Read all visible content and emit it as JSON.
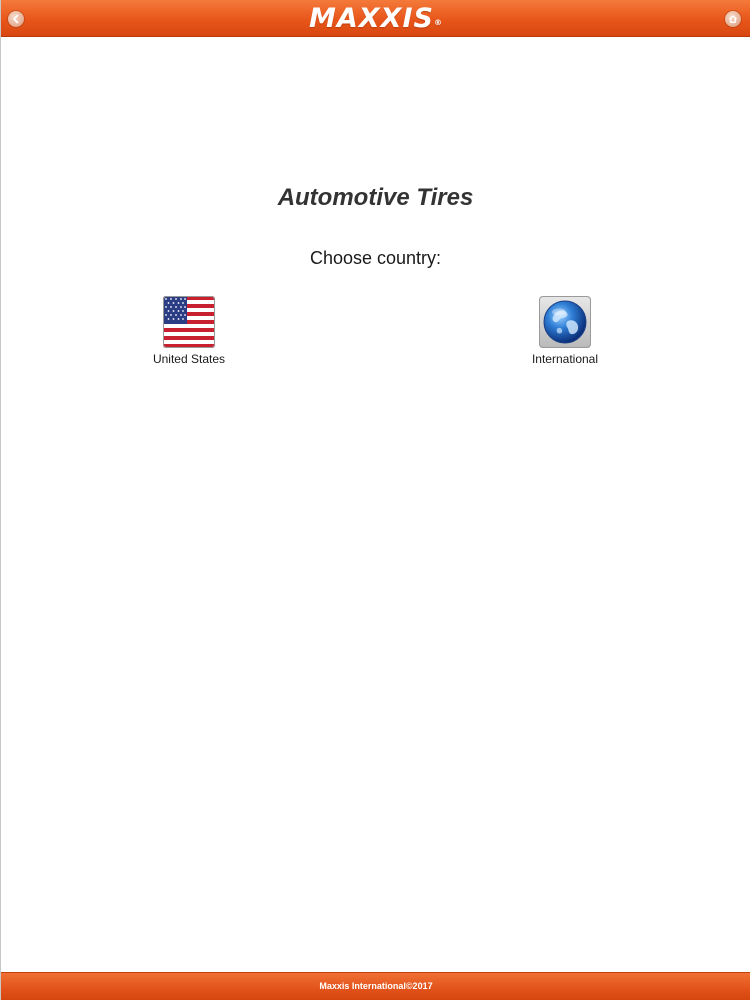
{
  "header": {
    "brand": "MAXXIS",
    "registered_mark": "®",
    "left_button_icon": "back-arrow-icon",
    "right_button_icon": "home-icon",
    "bar_color": "#e8561a"
  },
  "main": {
    "title": "Automotive Tires",
    "subtitle": "Choose country:",
    "countries": [
      {
        "label": "United States",
        "icon": "us-flag-icon"
      },
      {
        "label": "International",
        "icon": "globe-icon"
      }
    ]
  },
  "footer": {
    "copyright": "Maxxis International©2017"
  }
}
